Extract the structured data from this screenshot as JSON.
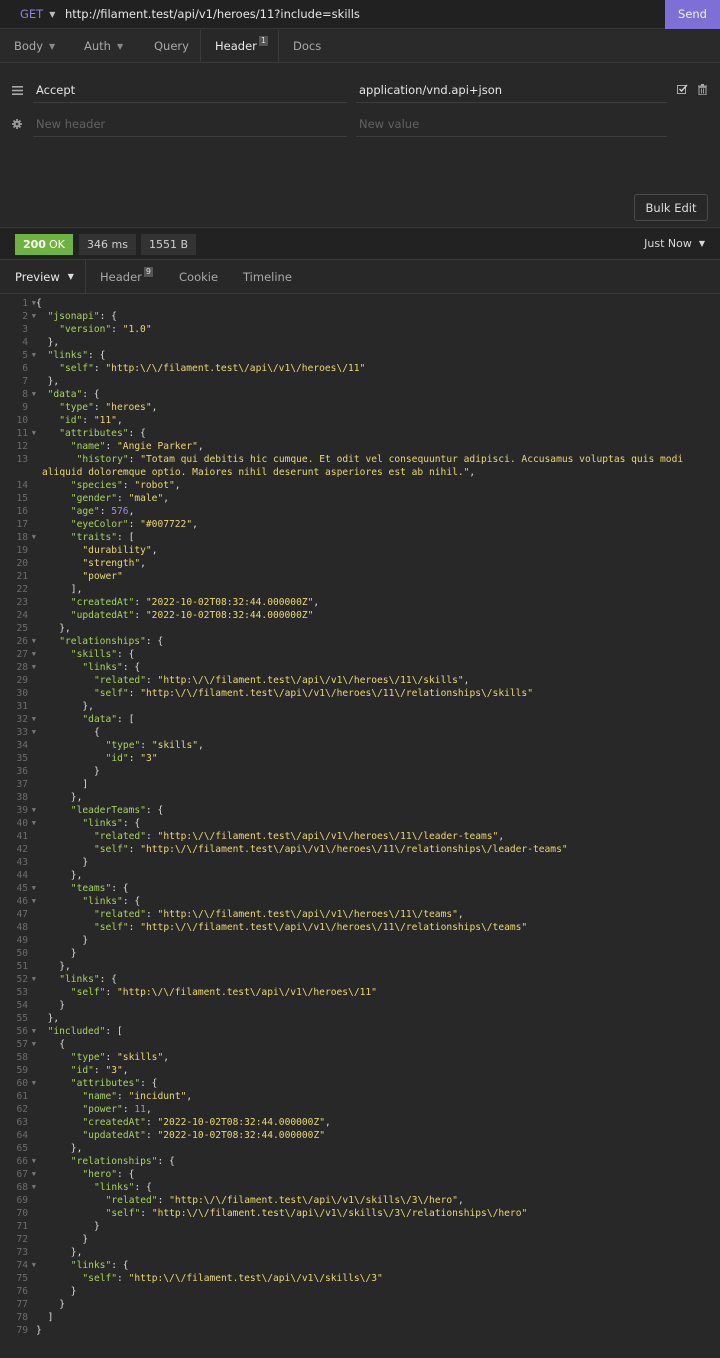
{
  "request": {
    "method": "GET",
    "url": "http://filament.test/api/v1/heroes/11?include=skills",
    "send_label": "Send"
  },
  "request_tabs": [
    {
      "label": "Body",
      "dropdown": true
    },
    {
      "label": "Auth",
      "dropdown": true
    },
    {
      "label": "Query"
    },
    {
      "label": "Header",
      "badge": "1",
      "active": true
    },
    {
      "label": "Docs"
    }
  ],
  "headers": {
    "rows": [
      {
        "name": "Accept",
        "value": "application/vnd.api+json",
        "enabled": true
      }
    ],
    "new_row": {
      "name_placeholder": "New header",
      "value_placeholder": "New value"
    },
    "bulk_edit_label": "Bulk Edit"
  },
  "response": {
    "status_code": "200",
    "status_text": "OK",
    "time": "346 ms",
    "size": "1551 B",
    "history_label": "Just Now",
    "colors": {
      "status_ok": "#6db33f",
      "send": "#7e6fd6",
      "method": "#8e7ee0"
    }
  },
  "response_tabs": [
    {
      "label": "Preview",
      "dropdown": true,
      "active": true
    },
    {
      "label": "Header",
      "badge": "9"
    },
    {
      "label": "Cookie"
    },
    {
      "label": "Timeline"
    }
  ],
  "body_lines": [
    {
      "n": 1,
      "fold": true,
      "indent": 0,
      "tokens": [
        [
          "p",
          "{"
        ]
      ]
    },
    {
      "n": 2,
      "fold": true,
      "indent": 1,
      "tokens": [
        [
          "k",
          "\"jsonapi\""
        ],
        [
          "p",
          ": {"
        ]
      ]
    },
    {
      "n": 3,
      "indent": 2,
      "tokens": [
        [
          "k",
          "\"version\""
        ],
        [
          "p",
          ": "
        ],
        [
          "s",
          "\"1.0\""
        ]
      ]
    },
    {
      "n": 4,
      "indent": 1,
      "tokens": [
        [
          "p",
          "},"
        ]
      ]
    },
    {
      "n": 5,
      "fold": true,
      "indent": 1,
      "tokens": [
        [
          "k",
          "\"links\""
        ],
        [
          "p",
          ": {"
        ]
      ]
    },
    {
      "n": 6,
      "indent": 2,
      "tokens": [
        [
          "k",
          "\"self\""
        ],
        [
          "p",
          ": "
        ],
        [
          "s",
          "\"http:\\/\\/filament.test\\/api\\/v1\\/heroes\\/11\""
        ]
      ]
    },
    {
      "n": 7,
      "indent": 1,
      "tokens": [
        [
          "p",
          "},"
        ]
      ]
    },
    {
      "n": 8,
      "fold": true,
      "indent": 1,
      "tokens": [
        [
          "k",
          "\"data\""
        ],
        [
          "p",
          ": {"
        ]
      ]
    },
    {
      "n": 9,
      "indent": 2,
      "tokens": [
        [
          "k",
          "\"type\""
        ],
        [
          "p",
          ": "
        ],
        [
          "s",
          "\"heroes\""
        ],
        [
          "p",
          ","
        ]
      ]
    },
    {
      "n": 10,
      "indent": 2,
      "tokens": [
        [
          "k",
          "\"id\""
        ],
        [
          "p",
          ": "
        ],
        [
          "s",
          "\"11\""
        ],
        [
          "p",
          ","
        ]
      ]
    },
    {
      "n": 11,
      "fold": true,
      "indent": 2,
      "tokens": [
        [
          "k",
          "\"attributes\""
        ],
        [
          "p",
          ": {"
        ]
      ]
    },
    {
      "n": 12,
      "indent": 3,
      "tokens": [
        [
          "k",
          "\"name\""
        ],
        [
          "p",
          ": "
        ],
        [
          "s",
          "\"Angie Parker\""
        ],
        [
          "p",
          ","
        ]
      ]
    },
    {
      "n": 13,
      "indent": 3,
      "tokens": [
        [
          "k",
          "\"history\""
        ],
        [
          "p",
          ": "
        ],
        [
          "s",
          "\"Totam qui debitis hic cumque. Et odit vel consequuntur adipisci. Accusamus voluptas quis modi aliquid doloremque optio. Maiores nihil deserunt asperiores est ab nihil.\""
        ],
        [
          "p",
          ","
        ]
      ]
    },
    {
      "n": 14,
      "indent": 3,
      "tokens": [
        [
          "k",
          "\"species\""
        ],
        [
          "p",
          ": "
        ],
        [
          "s",
          "\"robot\""
        ],
        [
          "p",
          ","
        ]
      ]
    },
    {
      "n": 15,
      "indent": 3,
      "tokens": [
        [
          "k",
          "\"gender\""
        ],
        [
          "p",
          ": "
        ],
        [
          "s",
          "\"male\""
        ],
        [
          "p",
          ","
        ]
      ]
    },
    {
      "n": 16,
      "indent": 3,
      "tokens": [
        [
          "k",
          "\"age\""
        ],
        [
          "p",
          ": "
        ],
        [
          "n",
          "576"
        ],
        [
          "p",
          ","
        ]
      ]
    },
    {
      "n": 17,
      "indent": 3,
      "tokens": [
        [
          "k",
          "\"eyeColor\""
        ],
        [
          "p",
          ": "
        ],
        [
          "s",
          "\"#007722\""
        ],
        [
          "p",
          ","
        ]
      ]
    },
    {
      "n": 18,
      "fold": true,
      "indent": 3,
      "tokens": [
        [
          "k",
          "\"traits\""
        ],
        [
          "p",
          ": ["
        ]
      ]
    },
    {
      "n": 19,
      "indent": 4,
      "tokens": [
        [
          "s",
          "\"durability\""
        ],
        [
          "p",
          ","
        ]
      ]
    },
    {
      "n": 20,
      "indent": 4,
      "tokens": [
        [
          "s",
          "\"strength\""
        ],
        [
          "p",
          ","
        ]
      ]
    },
    {
      "n": 21,
      "indent": 4,
      "tokens": [
        [
          "s",
          "\"power\""
        ]
      ]
    },
    {
      "n": 22,
      "indent": 3,
      "tokens": [
        [
          "p",
          "],"
        ]
      ]
    },
    {
      "n": 23,
      "indent": 3,
      "tokens": [
        [
          "k",
          "\"createdAt\""
        ],
        [
          "p",
          ": "
        ],
        [
          "s",
          "\"2022-10-02T08:32:44.000000Z\""
        ],
        [
          "p",
          ","
        ]
      ]
    },
    {
      "n": 24,
      "indent": 3,
      "tokens": [
        [
          "k",
          "\"updatedAt\""
        ],
        [
          "p",
          ": "
        ],
        [
          "s",
          "\"2022-10-02T08:32:44.000000Z\""
        ]
      ]
    },
    {
      "n": 25,
      "indent": 2,
      "tokens": [
        [
          "p",
          "},"
        ]
      ]
    },
    {
      "n": 26,
      "fold": true,
      "indent": 2,
      "tokens": [
        [
          "k",
          "\"relationships\""
        ],
        [
          "p",
          ": {"
        ]
      ]
    },
    {
      "n": 27,
      "fold": true,
      "indent": 3,
      "tokens": [
        [
          "k",
          "\"skills\""
        ],
        [
          "p",
          ": {"
        ]
      ]
    },
    {
      "n": 28,
      "fold": true,
      "indent": 4,
      "tokens": [
        [
          "k",
          "\"links\""
        ],
        [
          "p",
          ": {"
        ]
      ]
    },
    {
      "n": 29,
      "indent": 5,
      "tokens": [
        [
          "k",
          "\"related\""
        ],
        [
          "p",
          ": "
        ],
        [
          "s",
          "\"http:\\/\\/filament.test\\/api\\/v1\\/heroes\\/11\\/skills\""
        ],
        [
          "p",
          ","
        ]
      ]
    },
    {
      "n": 30,
      "indent": 5,
      "tokens": [
        [
          "k",
          "\"self\""
        ],
        [
          "p",
          ": "
        ],
        [
          "s",
          "\"http:\\/\\/filament.test\\/api\\/v1\\/heroes\\/11\\/relationships\\/skills\""
        ]
      ]
    },
    {
      "n": 31,
      "indent": 4,
      "tokens": [
        [
          "p",
          "},"
        ]
      ]
    },
    {
      "n": 32,
      "fold": true,
      "indent": 4,
      "tokens": [
        [
          "k",
          "\"data\""
        ],
        [
          "p",
          ": ["
        ]
      ]
    },
    {
      "n": 33,
      "fold": true,
      "indent": 5,
      "tokens": [
        [
          "p",
          "{"
        ]
      ]
    },
    {
      "n": 34,
      "indent": 6,
      "tokens": [
        [
          "k",
          "\"type\""
        ],
        [
          "p",
          ": "
        ],
        [
          "s",
          "\"skills\""
        ],
        [
          "p",
          ","
        ]
      ]
    },
    {
      "n": 35,
      "indent": 6,
      "tokens": [
        [
          "k",
          "\"id\""
        ],
        [
          "p",
          ": "
        ],
        [
          "s",
          "\"3\""
        ]
      ]
    },
    {
      "n": 36,
      "indent": 5,
      "tokens": [
        [
          "p",
          "}"
        ]
      ]
    },
    {
      "n": 37,
      "indent": 4,
      "tokens": [
        [
          "p",
          "]"
        ]
      ]
    },
    {
      "n": 38,
      "indent": 3,
      "tokens": [
        [
          "p",
          "},"
        ]
      ]
    },
    {
      "n": 39,
      "fold": true,
      "indent": 3,
      "tokens": [
        [
          "k",
          "\"leaderTeams\""
        ],
        [
          "p",
          ": {"
        ]
      ]
    },
    {
      "n": 40,
      "fold": true,
      "indent": 4,
      "tokens": [
        [
          "k",
          "\"links\""
        ],
        [
          "p",
          ": {"
        ]
      ]
    },
    {
      "n": 41,
      "indent": 5,
      "tokens": [
        [
          "k",
          "\"related\""
        ],
        [
          "p",
          ": "
        ],
        [
          "s",
          "\"http:\\/\\/filament.test\\/api\\/v1\\/heroes\\/11\\/leader-teams\""
        ],
        [
          "p",
          ","
        ]
      ]
    },
    {
      "n": 42,
      "indent": 5,
      "tokens": [
        [
          "k",
          "\"self\""
        ],
        [
          "p",
          ": "
        ],
        [
          "s",
          "\"http:\\/\\/filament.test\\/api\\/v1\\/heroes\\/11\\/relationships\\/leader-teams\""
        ]
      ]
    },
    {
      "n": 43,
      "indent": 4,
      "tokens": [
        [
          "p",
          "}"
        ]
      ]
    },
    {
      "n": 44,
      "indent": 3,
      "tokens": [
        [
          "p",
          "},"
        ]
      ]
    },
    {
      "n": 45,
      "fold": true,
      "indent": 3,
      "tokens": [
        [
          "k",
          "\"teams\""
        ],
        [
          "p",
          ": {"
        ]
      ]
    },
    {
      "n": 46,
      "fold": true,
      "indent": 4,
      "tokens": [
        [
          "k",
          "\"links\""
        ],
        [
          "p",
          ": {"
        ]
      ]
    },
    {
      "n": 47,
      "indent": 5,
      "tokens": [
        [
          "k",
          "\"related\""
        ],
        [
          "p",
          ": "
        ],
        [
          "s",
          "\"http:\\/\\/filament.test\\/api\\/v1\\/heroes\\/11\\/teams\""
        ],
        [
          "p",
          ","
        ]
      ]
    },
    {
      "n": 48,
      "indent": 5,
      "tokens": [
        [
          "k",
          "\"self\""
        ],
        [
          "p",
          ": "
        ],
        [
          "s",
          "\"http:\\/\\/filament.test\\/api\\/v1\\/heroes\\/11\\/relationships\\/teams\""
        ]
      ]
    },
    {
      "n": 49,
      "indent": 4,
      "tokens": [
        [
          "p",
          "}"
        ]
      ]
    },
    {
      "n": 50,
      "indent": 3,
      "tokens": [
        [
          "p",
          "}"
        ]
      ]
    },
    {
      "n": 51,
      "indent": 2,
      "tokens": [
        [
          "p",
          "},"
        ]
      ]
    },
    {
      "n": 52,
      "fold": true,
      "indent": 2,
      "tokens": [
        [
          "k",
          "\"links\""
        ],
        [
          "p",
          ": {"
        ]
      ]
    },
    {
      "n": 53,
      "indent": 3,
      "tokens": [
        [
          "k",
          "\"self\""
        ],
        [
          "p",
          ": "
        ],
        [
          "s",
          "\"http:\\/\\/filament.test\\/api\\/v1\\/heroes\\/11\""
        ]
      ]
    },
    {
      "n": 54,
      "indent": 2,
      "tokens": [
        [
          "p",
          "}"
        ]
      ]
    },
    {
      "n": 55,
      "indent": 1,
      "tokens": [
        [
          "p",
          "},"
        ]
      ]
    },
    {
      "n": 56,
      "fold": true,
      "indent": 1,
      "tokens": [
        [
          "k",
          "\"included\""
        ],
        [
          "p",
          ": ["
        ]
      ]
    },
    {
      "n": 57,
      "fold": true,
      "indent": 2,
      "tokens": [
        [
          "p",
          "{"
        ]
      ]
    },
    {
      "n": 58,
      "indent": 3,
      "tokens": [
        [
          "k",
          "\"type\""
        ],
        [
          "p",
          ": "
        ],
        [
          "s",
          "\"skills\""
        ],
        [
          "p",
          ","
        ]
      ]
    },
    {
      "n": 59,
      "indent": 3,
      "tokens": [
        [
          "k",
          "\"id\""
        ],
        [
          "p",
          ": "
        ],
        [
          "s",
          "\"3\""
        ],
        [
          "p",
          ","
        ]
      ]
    },
    {
      "n": 60,
      "fold": true,
      "indent": 3,
      "tokens": [
        [
          "k",
          "\"attributes\""
        ],
        [
          "p",
          ": {"
        ]
      ]
    },
    {
      "n": 61,
      "indent": 4,
      "tokens": [
        [
          "k",
          "\"name\""
        ],
        [
          "p",
          ": "
        ],
        [
          "s",
          "\"incidunt\""
        ],
        [
          "p",
          ","
        ]
      ]
    },
    {
      "n": 62,
      "indent": 4,
      "tokens": [
        [
          "k",
          "\"power\""
        ],
        [
          "p",
          ": "
        ],
        [
          "n",
          "11"
        ],
        [
          "p",
          ","
        ]
      ]
    },
    {
      "n": 63,
      "indent": 4,
      "tokens": [
        [
          "k",
          "\"createdAt\""
        ],
        [
          "p",
          ": "
        ],
        [
          "s",
          "\"2022-10-02T08:32:44.000000Z\""
        ],
        [
          "p",
          ","
        ]
      ]
    },
    {
      "n": 64,
      "indent": 4,
      "tokens": [
        [
          "k",
          "\"updatedAt\""
        ],
        [
          "p",
          ": "
        ],
        [
          "s",
          "\"2022-10-02T08:32:44.000000Z\""
        ]
      ]
    },
    {
      "n": 65,
      "indent": 3,
      "tokens": [
        [
          "p",
          "},"
        ]
      ]
    },
    {
      "n": 66,
      "fold": true,
      "indent": 3,
      "tokens": [
        [
          "k",
          "\"relationships\""
        ],
        [
          "p",
          ": {"
        ]
      ]
    },
    {
      "n": 67,
      "fold": true,
      "indent": 4,
      "tokens": [
        [
          "k",
          "\"hero\""
        ],
        [
          "p",
          ": {"
        ]
      ]
    },
    {
      "n": 68,
      "fold": true,
      "indent": 5,
      "tokens": [
        [
          "k",
          "\"links\""
        ],
        [
          "p",
          ": {"
        ]
      ]
    },
    {
      "n": 69,
      "indent": 6,
      "tokens": [
        [
          "k",
          "\"related\""
        ],
        [
          "p",
          ": "
        ],
        [
          "s",
          "\"http:\\/\\/filament.test\\/api\\/v1\\/skills\\/3\\/hero\""
        ],
        [
          "p",
          ","
        ]
      ]
    },
    {
      "n": 70,
      "indent": 6,
      "tokens": [
        [
          "k",
          "\"self\""
        ],
        [
          "p",
          ": "
        ],
        [
          "s",
          "\"http:\\/\\/filament.test\\/api\\/v1\\/skills\\/3\\/relationships\\/hero\""
        ]
      ]
    },
    {
      "n": 71,
      "indent": 5,
      "tokens": [
        [
          "p",
          "}"
        ]
      ]
    },
    {
      "n": 72,
      "indent": 4,
      "tokens": [
        [
          "p",
          "}"
        ]
      ]
    },
    {
      "n": 73,
      "indent": 3,
      "tokens": [
        [
          "p",
          "},"
        ]
      ]
    },
    {
      "n": 74,
      "fold": true,
      "indent": 3,
      "tokens": [
        [
          "k",
          "\"links\""
        ],
        [
          "p",
          ": {"
        ]
      ]
    },
    {
      "n": 75,
      "indent": 4,
      "tokens": [
        [
          "k",
          "\"self\""
        ],
        [
          "p",
          ": "
        ],
        [
          "s",
          "\"http:\\/\\/filament.test\\/api\\/v1\\/skills\\/3\""
        ]
      ]
    },
    {
      "n": 76,
      "indent": 3,
      "tokens": [
        [
          "p",
          "}"
        ]
      ]
    },
    {
      "n": 77,
      "indent": 2,
      "tokens": [
        [
          "p",
          "}"
        ]
      ]
    },
    {
      "n": 78,
      "indent": 1,
      "tokens": [
        [
          "p",
          "]"
        ]
      ]
    },
    {
      "n": 79,
      "indent": 0,
      "tokens": [
        [
          "p",
          "}"
        ]
      ]
    }
  ]
}
